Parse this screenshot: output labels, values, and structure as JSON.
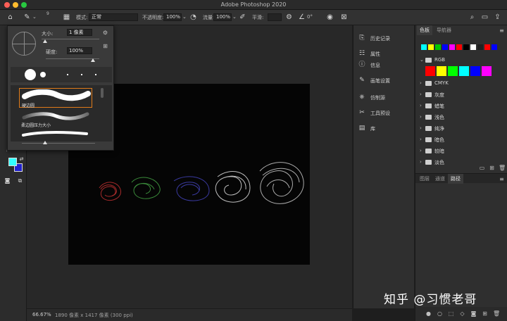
{
  "window": {
    "title": "Adobe Photoshop 2020"
  },
  "options_bar": {
    "brush_size": "9",
    "mode_label": "模式:",
    "mode_value": "正常",
    "opacity_label": "不透明度:",
    "opacity_value": "100%",
    "flow_label": "流量:",
    "flow_value": "100%",
    "smoothing_label": "平滑:",
    "angle_value": "0°"
  },
  "brush_popup": {
    "size_label": "大小:",
    "size_value": "1 像素",
    "hardness_label": "硬度:",
    "hardness_value": "100%",
    "preset_1_label": "硬边圆",
    "preset_2_label": "柔边圆压力大小"
  },
  "mid_panel": {
    "items": [
      {
        "label": "历史记录",
        "icon": "history-icon"
      },
      {
        "label": "属性",
        "icon": "properties-icon"
      },
      {
        "label": "信息",
        "icon": "info-icon"
      },
      {
        "label": "画笔设置",
        "icon": "brush-settings-icon"
      },
      {
        "label": "仿制源",
        "icon": "clone-source-icon"
      },
      {
        "label": "工具预设",
        "icon": "tool-presets-icon"
      },
      {
        "label": "库",
        "icon": "library-icon"
      }
    ]
  },
  "right_panel": {
    "tabs": [
      "色板",
      "导航器"
    ],
    "folders": [
      "RGB",
      "CMYK",
      "灰度",
      "蜡笔",
      "浅色",
      "纯净",
      "暗色",
      "较暗",
      "淡色"
    ],
    "bottom_tabs": [
      "图层",
      "通道",
      "路径"
    ]
  },
  "status": {
    "zoom": "66.67%",
    "doc_info": "1890 像素 x 1417 像素 (300 ppi)"
  },
  "watermark": "知乎 @习惯老哥",
  "colors": {
    "foreground": "#33ffff",
    "background": "#2222cc",
    "accent_border": "#e07b1a"
  },
  "swatches_small": [
    "#00ffff",
    "#ffff00",
    "#00c800",
    "#0000ff",
    "#ff00ff",
    "#ff0000",
    "#000000",
    "#ffffff",
    "#202020",
    "#ff0000",
    "#0000ff"
  ],
  "swatches_rgb": [
    "#ff0000",
    "#ffff00",
    "#00ff00",
    "#00ffff",
    "#0000ff",
    "#ff00ff"
  ]
}
